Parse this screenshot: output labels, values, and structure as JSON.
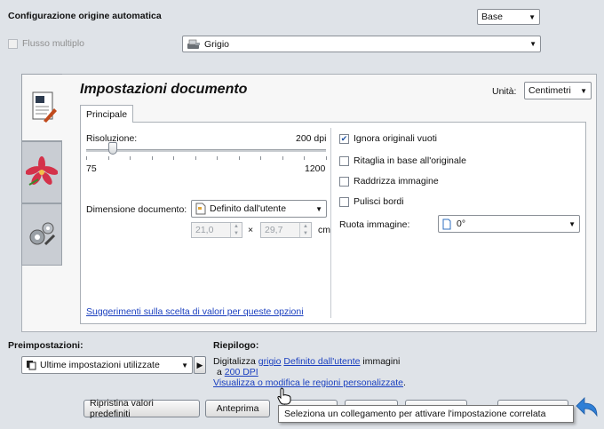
{
  "header": {
    "title": "Configurazione origine automatica",
    "mode_select": "Base",
    "multi_flow_label": "Flusso multiplo",
    "color_select": "Grigio"
  },
  "panel": {
    "title": "Impostazioni documento",
    "unit_label": "Unità:",
    "unit_select": "Centimetri",
    "tab_label": "Principale"
  },
  "resolution": {
    "label": "Risoluzione:",
    "value": "200 dpi",
    "min": "75",
    "max": "1200",
    "slider_value": 200,
    "slider_min": 75,
    "slider_max": 1200
  },
  "document_size": {
    "label": "Dimensione documento:",
    "select": "Definito dall'utente",
    "width": "21,0",
    "times": "×",
    "height": "29,7",
    "unit": "cm"
  },
  "options": {
    "ignore_blank": "Ignora originali vuoti",
    "crop_original": "Ritaglia in base all'originale",
    "straighten": "Raddrizza immagine",
    "clean_edges": "Pulisci bordi",
    "rotate_label": "Ruota immagine:",
    "rotate_select": "0°"
  },
  "help_link": "Suggerimenti sulla scelta di valori per queste opzioni",
  "presets": {
    "label": "Preimpostazioni:",
    "select": "Ultime impostazioni utilizzate"
  },
  "summary": {
    "label": "Riepilogo:",
    "line1_prefix": "Digitalizza",
    "link_gray": "grigio",
    "link_custom": "Definito dall'utente",
    "line1_suffix": "immagini",
    "line2_prefix": "a",
    "link_dpi": "200 DPI",
    "link_view": "Visualizza o modifica le regioni personalizzate",
    "line3_suffix": "."
  },
  "buttons": {
    "restore_defaults": "Ripristina valori predefiniti",
    "preview": "Anteprima"
  },
  "tooltip": "Seleziona un collegamento per attivare l'impostazione correlata",
  "icons": {
    "color": "scanner-gray-icon",
    "document_tab": "document-settings-icon",
    "image_tab": "flower-image-icon",
    "advanced_tab": "gears-icon",
    "back": "back-arrow-icon"
  },
  "colors": {
    "window_bg": "#dfe3e8",
    "link": "#1a3fbf",
    "back_arrow": "#2f7fd6"
  }
}
